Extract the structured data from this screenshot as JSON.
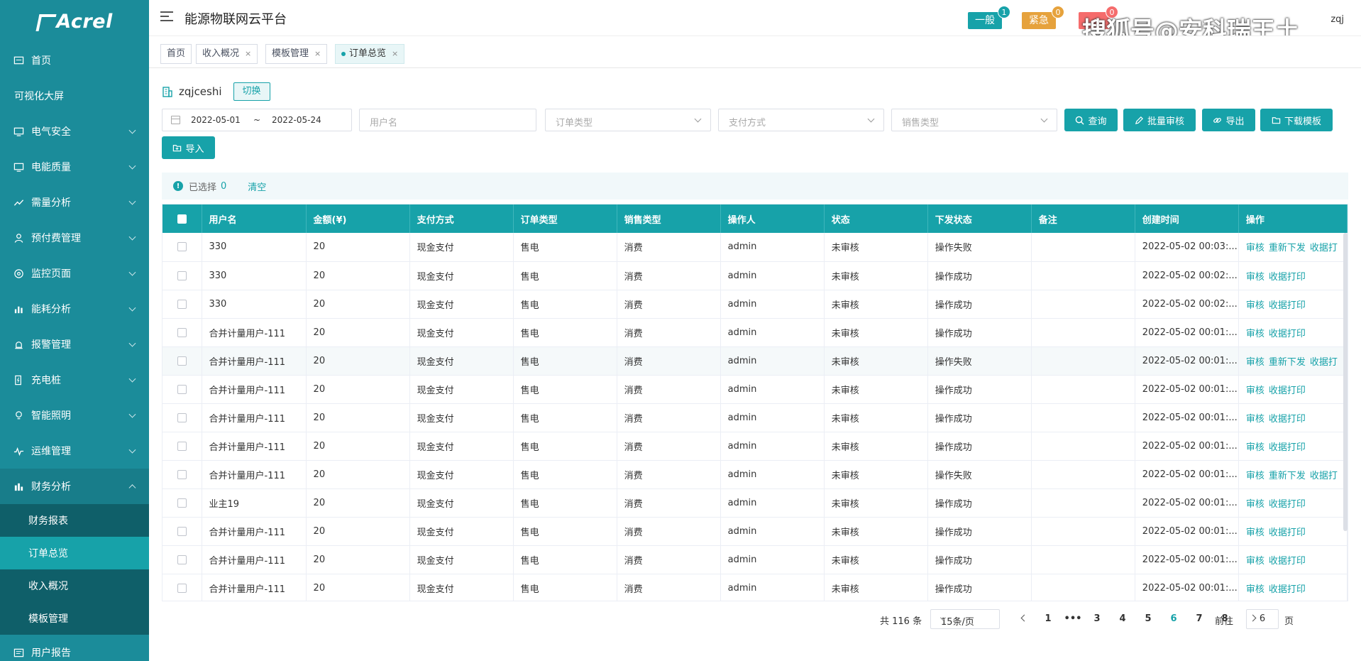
{
  "logo": "Acrel",
  "sidebar": {
    "items": [
      {
        "label": "首页",
        "icon": "dashboard-icon",
        "chevron": false
      },
      {
        "label": "可视化大屏",
        "icon": "",
        "chevron": false
      },
      {
        "label": "电气安全",
        "icon": "monitor-icon",
        "chevron": true
      },
      {
        "label": "电能质量",
        "icon": "monitor-icon",
        "chevron": true
      },
      {
        "label": "需量分析",
        "icon": "trend-icon",
        "chevron": true
      },
      {
        "label": "预付费管理",
        "icon": "user-icon",
        "chevron": true
      },
      {
        "label": "监控页面",
        "icon": "target-icon",
        "chevron": true
      },
      {
        "label": "能耗分析",
        "icon": "bar-chart-icon",
        "chevron": true
      },
      {
        "label": "报警管理",
        "icon": "alarm-icon",
        "chevron": true
      },
      {
        "label": "充电桩",
        "icon": "charger-icon",
        "chevron": true
      },
      {
        "label": "智能照明",
        "icon": "bulb-icon",
        "chevron": true
      },
      {
        "label": "运维管理",
        "icon": "wave-icon",
        "chevron": true
      },
      {
        "label": "财务分析",
        "icon": "finance-icon",
        "chevron": true,
        "open": true
      }
    ],
    "submenu": [
      {
        "label": "财务报表",
        "active": false
      },
      {
        "label": "订单总览",
        "active": true
      },
      {
        "label": "收入概况",
        "active": false
      },
      {
        "label": "模板管理",
        "active": false
      }
    ],
    "last_item": {
      "label": "用户报告",
      "icon": "report-icon"
    }
  },
  "header": {
    "title": "能源物联网云平台",
    "badges": [
      {
        "label": "一般",
        "count": "1",
        "color": "#17a2a9"
      },
      {
        "label": "紧急",
        "count": "0",
        "color": "#e6a23c"
      },
      {
        "label": "",
        "count": "0",
        "color": "#f56c6c"
      }
    ],
    "watermark": "搜狐号@安科瑞王土",
    "user": "zqj"
  },
  "tabs": [
    {
      "label": "首页",
      "closable": false,
      "active": false
    },
    {
      "label": "收入概况",
      "closable": true,
      "active": false
    },
    {
      "label": "模板管理",
      "closable": true,
      "active": false
    },
    {
      "label": "订单总览",
      "closable": true,
      "active": true
    }
  ],
  "org": {
    "name": "zqjceshi",
    "switch_label": "切换"
  },
  "filters": {
    "date_start": "2022-05-01",
    "date_sep": "~",
    "date_end": "2022-05-24",
    "username_placeholder": "用户名",
    "order_type_placeholder": "订单类型",
    "payment_placeholder": "支付方式",
    "sales_type_placeholder": "销售类型"
  },
  "actions": {
    "query": "查询",
    "batch_review": "批量审核",
    "export": "导出",
    "download_template": "下载模板",
    "import": "导入"
  },
  "selection": {
    "label": "已选择",
    "count": "0",
    "clear": "清空"
  },
  "table": {
    "headers": [
      "",
      "用户名",
      "金额(¥)",
      "支付方式",
      "订单类型",
      "销售类型",
      "操作人",
      "状态",
      "下发状态",
      "备注",
      "创建时间",
      "操作"
    ],
    "rows": [
      {
        "user": "330",
        "amount": "20",
        "pay": "现金支付",
        "otype": "售电",
        "stype": "消费",
        "op": "admin",
        "status": "未审核",
        "dstatus": "操作失败",
        "note": "",
        "time": "2022-05-02 00:03:...",
        "actions": [
          "审核",
          "重新下发",
          "收据打"
        ]
      },
      {
        "user": "330",
        "amount": "20",
        "pay": "现金支付",
        "otype": "售电",
        "stype": "消费",
        "op": "admin",
        "status": "未审核",
        "dstatus": "操作成功",
        "note": "",
        "time": "2022-05-02 00:02:...",
        "actions": [
          "审核",
          "收据打印"
        ]
      },
      {
        "user": "330",
        "amount": "20",
        "pay": "现金支付",
        "otype": "售电",
        "stype": "消费",
        "op": "admin",
        "status": "未审核",
        "dstatus": "操作成功",
        "note": "",
        "time": "2022-05-02 00:02:...",
        "actions": [
          "审核",
          "收据打印"
        ]
      },
      {
        "user": "合并计量用户-111",
        "amount": "20",
        "pay": "现金支付",
        "otype": "售电",
        "stype": "消费",
        "op": "admin",
        "status": "未审核",
        "dstatus": "操作成功",
        "note": "",
        "time": "2022-05-02 00:01:...",
        "actions": [
          "审核",
          "收据打印"
        ]
      },
      {
        "user": "合并计量用户-111",
        "amount": "20",
        "pay": "现金支付",
        "otype": "售电",
        "stype": "消费",
        "op": "admin",
        "status": "未审核",
        "dstatus": "操作失败",
        "note": "",
        "time": "2022-05-02 00:01:...",
        "actions": [
          "审核",
          "重新下发",
          "收据打"
        ],
        "highlight": true
      },
      {
        "user": "合并计量用户-111",
        "amount": "20",
        "pay": "现金支付",
        "otype": "售电",
        "stype": "消费",
        "op": "admin",
        "status": "未审核",
        "dstatus": "操作成功",
        "note": "",
        "time": "2022-05-02 00:01:...",
        "actions": [
          "审核",
          "收据打印"
        ]
      },
      {
        "user": "合并计量用户-111",
        "amount": "20",
        "pay": "现金支付",
        "otype": "售电",
        "stype": "消费",
        "op": "admin",
        "status": "未审核",
        "dstatus": "操作成功",
        "note": "",
        "time": "2022-05-02 00:01:...",
        "actions": [
          "审核",
          "收据打印"
        ]
      },
      {
        "user": "合并计量用户-111",
        "amount": "20",
        "pay": "现金支付",
        "otype": "售电",
        "stype": "消费",
        "op": "admin",
        "status": "未审核",
        "dstatus": "操作成功",
        "note": "",
        "time": "2022-05-02 00:01:...",
        "actions": [
          "审核",
          "收据打印"
        ]
      },
      {
        "user": "合并计量用户-111",
        "amount": "20",
        "pay": "现金支付",
        "otype": "售电",
        "stype": "消费",
        "op": "admin",
        "status": "未审核",
        "dstatus": "操作失败",
        "note": "",
        "time": "2022-05-02 00:01:...",
        "actions": [
          "审核",
          "重新下发",
          "收据打"
        ]
      },
      {
        "user": "业主19",
        "amount": "20",
        "pay": "现金支付",
        "otype": "售电",
        "stype": "消费",
        "op": "admin",
        "status": "未审核",
        "dstatus": "操作成功",
        "note": "",
        "time": "2022-05-02 00:01:...",
        "actions": [
          "审核",
          "收据打印"
        ]
      },
      {
        "user": "合并计量用户-111",
        "amount": "20",
        "pay": "现金支付",
        "otype": "售电",
        "stype": "消费",
        "op": "admin",
        "status": "未审核",
        "dstatus": "操作成功",
        "note": "",
        "time": "2022-05-02 00:01:...",
        "actions": [
          "审核",
          "收据打印"
        ]
      },
      {
        "user": "合并计量用户-111",
        "amount": "20",
        "pay": "现金支付",
        "otype": "售电",
        "stype": "消费",
        "op": "admin",
        "status": "未审核",
        "dstatus": "操作成功",
        "note": "",
        "time": "2022-05-02 00:01:...",
        "actions": [
          "审核",
          "收据打印"
        ]
      },
      {
        "user": "合并计量用户-111",
        "amount": "20",
        "pay": "现金支付",
        "otype": "售电",
        "stype": "消费",
        "op": "admin",
        "status": "未审核",
        "dstatus": "操作成功",
        "note": "",
        "time": "2022-05-02 00:01:...",
        "actions": [
          "审核",
          "收据打印"
        ]
      }
    ]
  },
  "pagination": {
    "total": "共 116 条",
    "page_size": "15条/页",
    "pages": [
      "1",
      "•••",
      "3",
      "4",
      "5",
      "6",
      "7",
      "8"
    ],
    "current": "6",
    "goto_label": "前往",
    "goto_value": "6",
    "goto_suffix": "页"
  }
}
